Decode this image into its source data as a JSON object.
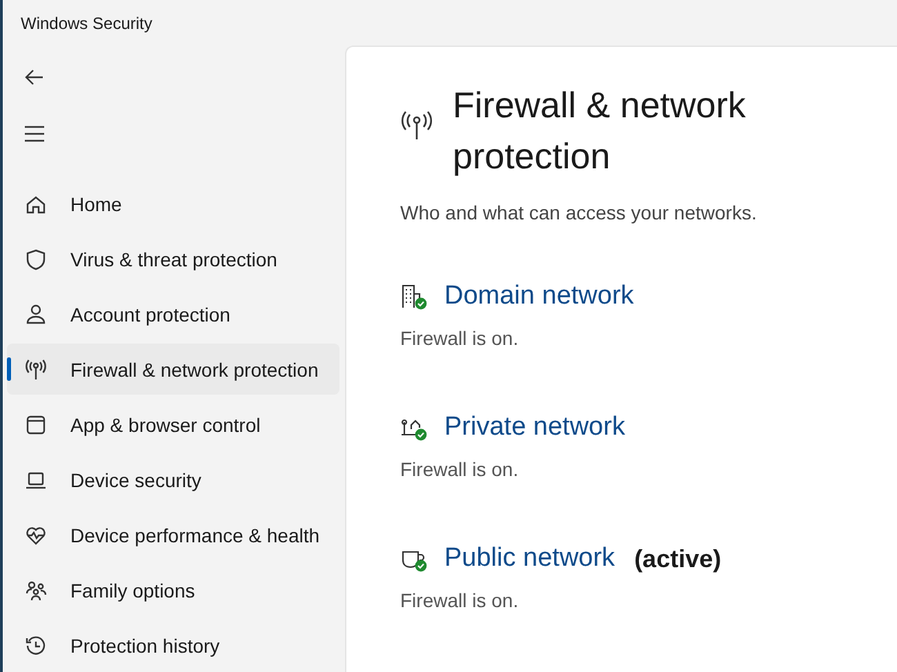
{
  "window": {
    "title": "Windows Security"
  },
  "sidebar": {
    "items": [
      {
        "label": "Home",
        "selected": false
      },
      {
        "label": "Virus & threat protection",
        "selected": false
      },
      {
        "label": "Account protection",
        "selected": false
      },
      {
        "label": "Firewall & network protection",
        "selected": true
      },
      {
        "label": "App & browser control",
        "selected": false
      },
      {
        "label": "Device security",
        "selected": false
      },
      {
        "label": "Device performance & health",
        "selected": false
      },
      {
        "label": "Family options",
        "selected": false
      },
      {
        "label": "Protection history",
        "selected": false
      }
    ]
  },
  "page": {
    "title": "Firewall & network protection",
    "subtitle": "Who and what can access your networks.",
    "networks": [
      {
        "name": "Domain network",
        "status": "Firewall is on."
      },
      {
        "name": "Private network",
        "status": "Firewall is on."
      },
      {
        "name": "Public network",
        "active_label": "(active)",
        "status": "Firewall is on."
      }
    ]
  }
}
